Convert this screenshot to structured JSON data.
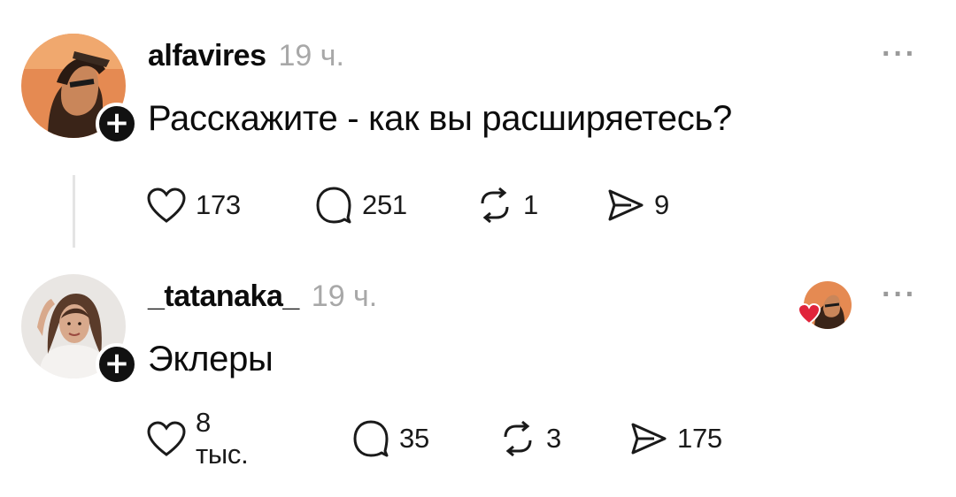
{
  "posts": [
    {
      "username": "alfavires",
      "time": "19 ч.",
      "text": "Расскажите - как вы расширяетесь?",
      "more": "···",
      "actions": {
        "likes": "173",
        "comments": "251",
        "reposts": "1",
        "shares": "9"
      }
    },
    {
      "username": "_tatanaka_",
      "time": "19 ч.",
      "text": "Эклеры",
      "more": "···",
      "actions": {
        "likes": "8 тыс.",
        "comments": "35",
        "reposts": "3",
        "shares": "175"
      }
    }
  ],
  "icons": {
    "follow": "plus-icon",
    "like": "heart-icon",
    "comment": "comment-icon",
    "repost": "repost-icon",
    "share": "send-icon",
    "more": "more-icon"
  },
  "colors": {
    "accent_heart": "#e0243b",
    "muted": "#a8a8a8",
    "text": "#0c0c0c"
  }
}
